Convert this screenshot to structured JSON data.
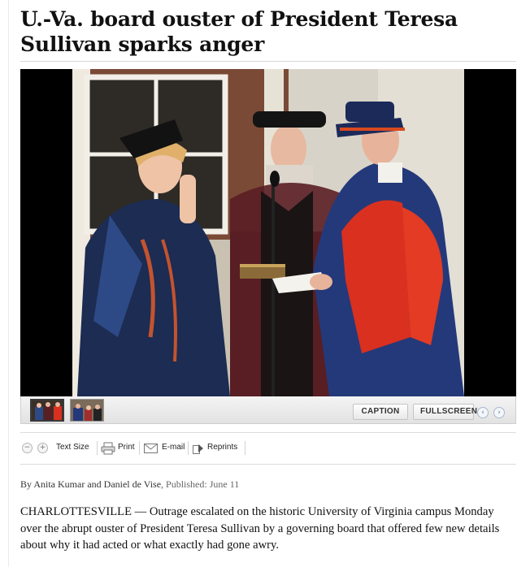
{
  "article": {
    "headline": "U.-Va. board ouster of President Teresa Sullivan sparks anger",
    "byline_prefix": "By ",
    "author1": "Anita Kumar",
    "and": " and ",
    "author2": "Daniel de Vise",
    "published": ", Published: June 11",
    "lead": "CHARLOTTESVILLE — Outrage escalated on the historic University of Virginia campus Monday over the abrupt ouster of President Teresa Sullivan by a governing board that offered few new details about why it had acted or what exactly had gone awry."
  },
  "gallery": {
    "caption_label": "CAPTION",
    "fullscreen_label": "FULLSCREEN",
    "prev_icon": "chevron-left-icon",
    "next_icon": "chevron-right-icon"
  },
  "tools": {
    "zoom_out": "−",
    "zoom_in": "+",
    "text_size": "Text Size",
    "print": "Print",
    "email": "E-mail",
    "reprints": "Reprints"
  }
}
